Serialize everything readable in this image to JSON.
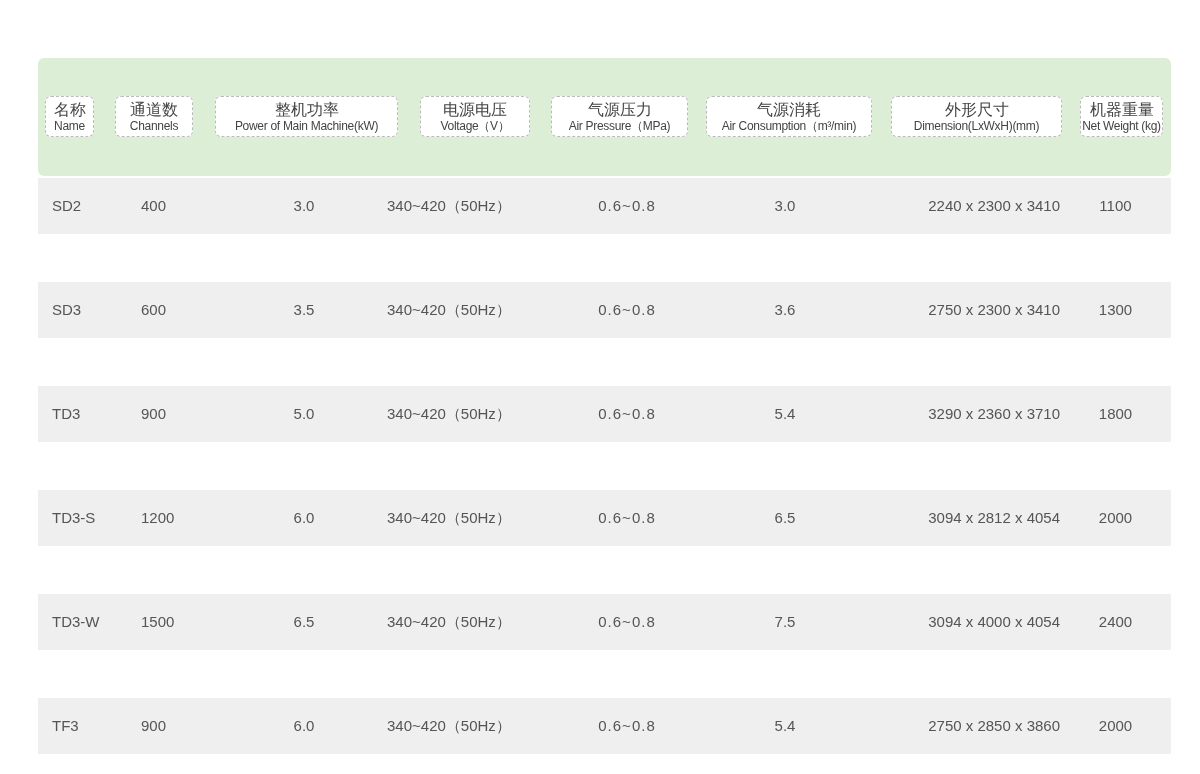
{
  "table": {
    "columns": [
      {
        "zh": "名称",
        "en": "Name"
      },
      {
        "zh": "通道数",
        "en": "Channels"
      },
      {
        "zh": "整机功率",
        "en": "Power of Main Machine(kW)"
      },
      {
        "zh": "电源电压",
        "en": "Voltage（V）"
      },
      {
        "zh": "气源压力",
        "en": "Air Pressure（MPa)"
      },
      {
        "zh": "气源消耗",
        "en": "Air Consumption（m³/min)"
      },
      {
        "zh": "外形尺寸",
        "en": "Dimension(LxWxH)(mm)"
      },
      {
        "zh": "机器重量",
        "en": "Net Weight (kg)"
      }
    ],
    "rows": [
      [
        "SD2",
        "400",
        "3.0",
        "340~420（50Hz）",
        "0.6~0.8",
        "3.0",
        "2240 x 2300 x 3410",
        "1100"
      ],
      [
        "SD3",
        "600",
        "3.5",
        "340~420（50Hz）",
        "0.6~0.8",
        "3.6",
        "2750 x 2300 x 3410",
        "1300"
      ],
      [
        "TD3",
        "900",
        "5.0",
        "340~420（50Hz）",
        "0.6~0.8",
        "5.4",
        "3290 x 2360 x 3710",
        "1800"
      ],
      [
        "TD3-S",
        "1200",
        "6.0",
        "340~420（50Hz）",
        "0.6~0.8",
        "6.5",
        "3094 x 2812 x 4054",
        "2000"
      ],
      [
        "TD3-W",
        "1500",
        "6.5",
        "340~420（50Hz）",
        "0.6~0.8",
        "7.5",
        "3094 x 4000 x 4054",
        "2400"
      ],
      [
        "TF3",
        "900",
        "6.0",
        "340~420（50Hz）",
        "0.6~0.8",
        "5.4",
        "2750 x 2850 x 3860",
        "2000"
      ]
    ]
  }
}
